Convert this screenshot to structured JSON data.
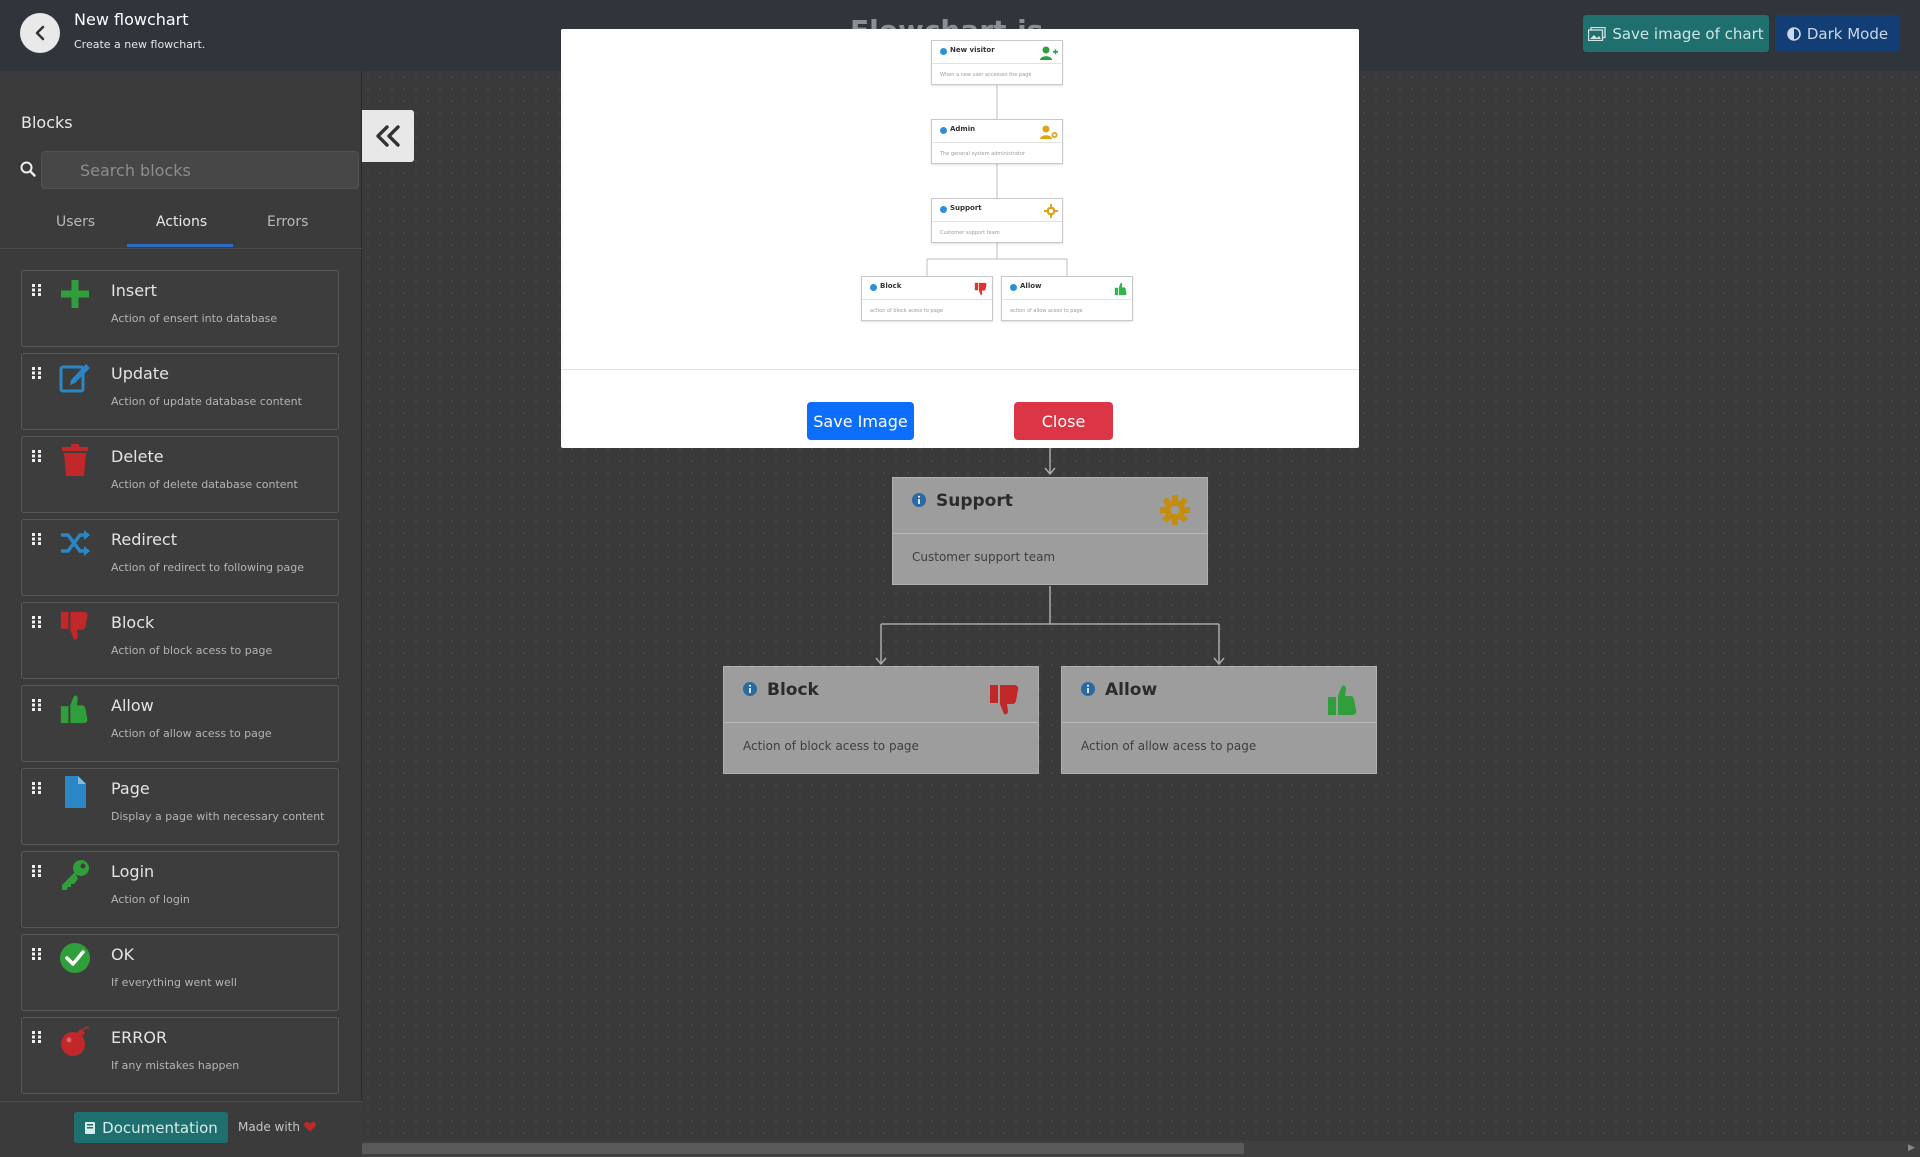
{
  "header": {
    "title": "New flowchart",
    "subtitle": "Create a new flowchart.",
    "center_title": "Flowchart.js",
    "save_image_chart_label": "Save image of chart",
    "dark_mode_label": "Dark Mode"
  },
  "sidebar": {
    "title": "Blocks",
    "search_placeholder": "Search blocks",
    "tabs": [
      {
        "label": "Users"
      },
      {
        "label": "Actions"
      },
      {
        "label": "Errors"
      }
    ],
    "blocks": [
      {
        "name": "Insert",
        "desc": "Action of ensert into database",
        "icon": "plus-icon"
      },
      {
        "name": "Update",
        "desc": "Action of update database content",
        "icon": "edit-icon"
      },
      {
        "name": "Delete",
        "desc": "Action of delete database content",
        "icon": "trash-icon"
      },
      {
        "name": "Redirect",
        "desc": "Action of redirect to following page",
        "icon": "shuffle-icon"
      },
      {
        "name": "Block",
        "desc": "Action of block acess to page",
        "icon": "thumbs-down-icon"
      },
      {
        "name": "Allow",
        "desc": "Action of allow acess to page",
        "icon": "thumbs-up-icon"
      },
      {
        "name": "Page",
        "desc": "Display a page with necessary content",
        "icon": "file-icon"
      },
      {
        "name": "Login",
        "desc": "Action of login",
        "icon": "key-icon"
      },
      {
        "name": "OK",
        "desc": "If everything went well",
        "icon": "check-circle-icon"
      },
      {
        "name": "ERROR",
        "desc": "If any mistakes happen",
        "icon": "bomb-icon"
      }
    ],
    "footer": {
      "docs_label": "Documentation",
      "made_with": "Made with"
    }
  },
  "canvas": {
    "nodes": [
      {
        "name": "Support",
        "desc": "Customer support team",
        "icon": "gear-icon"
      },
      {
        "name": "Block",
        "desc": "Action of block acess to page",
        "icon": "thumbs-down-icon"
      },
      {
        "name": "Allow",
        "desc": "Action of allow acess to page",
        "icon": "thumbs-up-icon"
      }
    ]
  },
  "modal": {
    "preview_nodes": [
      {
        "name": "New visitor",
        "desc": "When a new user accesses the page"
      },
      {
        "name": "Admin",
        "desc": "The general system administrator"
      },
      {
        "name": "Support",
        "desc": "Customer support team"
      },
      {
        "name": "Block",
        "desc": "action of block acess to page"
      },
      {
        "name": "Allow",
        "desc": "action of allow acess to page"
      }
    ],
    "save_label": "Save Image",
    "close_label": "Close"
  },
  "colors": {
    "header_bg": "#2f353b",
    "teal_button": "#1e6f6d",
    "blue_button": "#0d6efd",
    "red_button": "#dc3545",
    "active_tab": "#2b6cc4"
  }
}
